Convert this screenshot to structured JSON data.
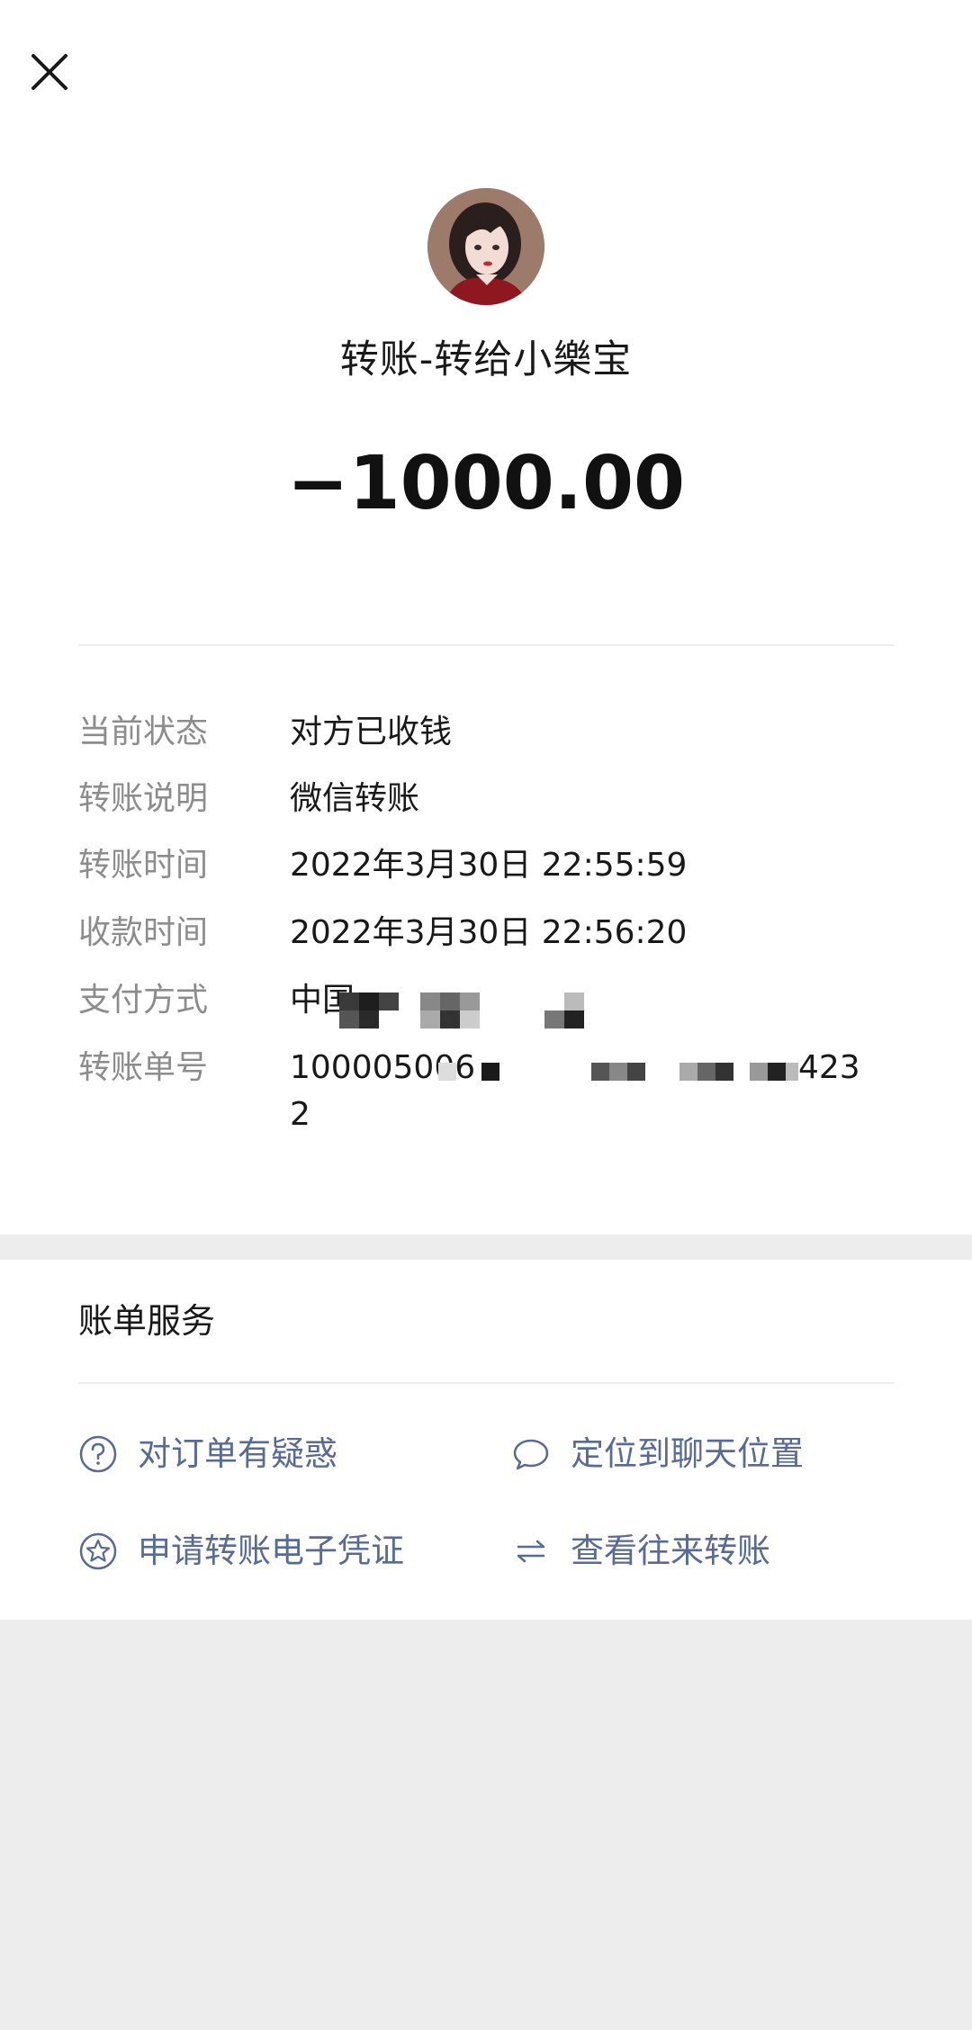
{
  "header": {
    "close_icon": "close-icon"
  },
  "transfer": {
    "title": "转账-转给小樂宝",
    "amount": "−1000.00"
  },
  "details": [
    {
      "label": "当前状态",
      "value": "对方已收钱"
    },
    {
      "label": "转账说明",
      "value": "微信转账"
    },
    {
      "label": "转账时间",
      "value": "2022年3月30日 22:55:59"
    },
    {
      "label": "收款时间",
      "value": "2022年3月30日 22:56:20"
    },
    {
      "label": "支付方式",
      "value": "中国"
    },
    {
      "label": "转账单号",
      "value": "100005006",
      "value_tail": "423",
      "value_line2": "2"
    }
  ],
  "services": {
    "heading": "账单服务",
    "items": [
      {
        "label": "对订单有疑惑",
        "icon": "question-circle-icon"
      },
      {
        "label": "定位到聊天位置",
        "icon": "chat-bubble-icon"
      },
      {
        "label": "申请转账电子凭证",
        "icon": "star-circle-icon"
      },
      {
        "label": "查看往来转账",
        "icon": "swap-arrows-icon"
      }
    ]
  },
  "colors": {
    "link": "#576b95",
    "label": "#8c8c8c",
    "text": "#191919",
    "background": "#ededed"
  }
}
